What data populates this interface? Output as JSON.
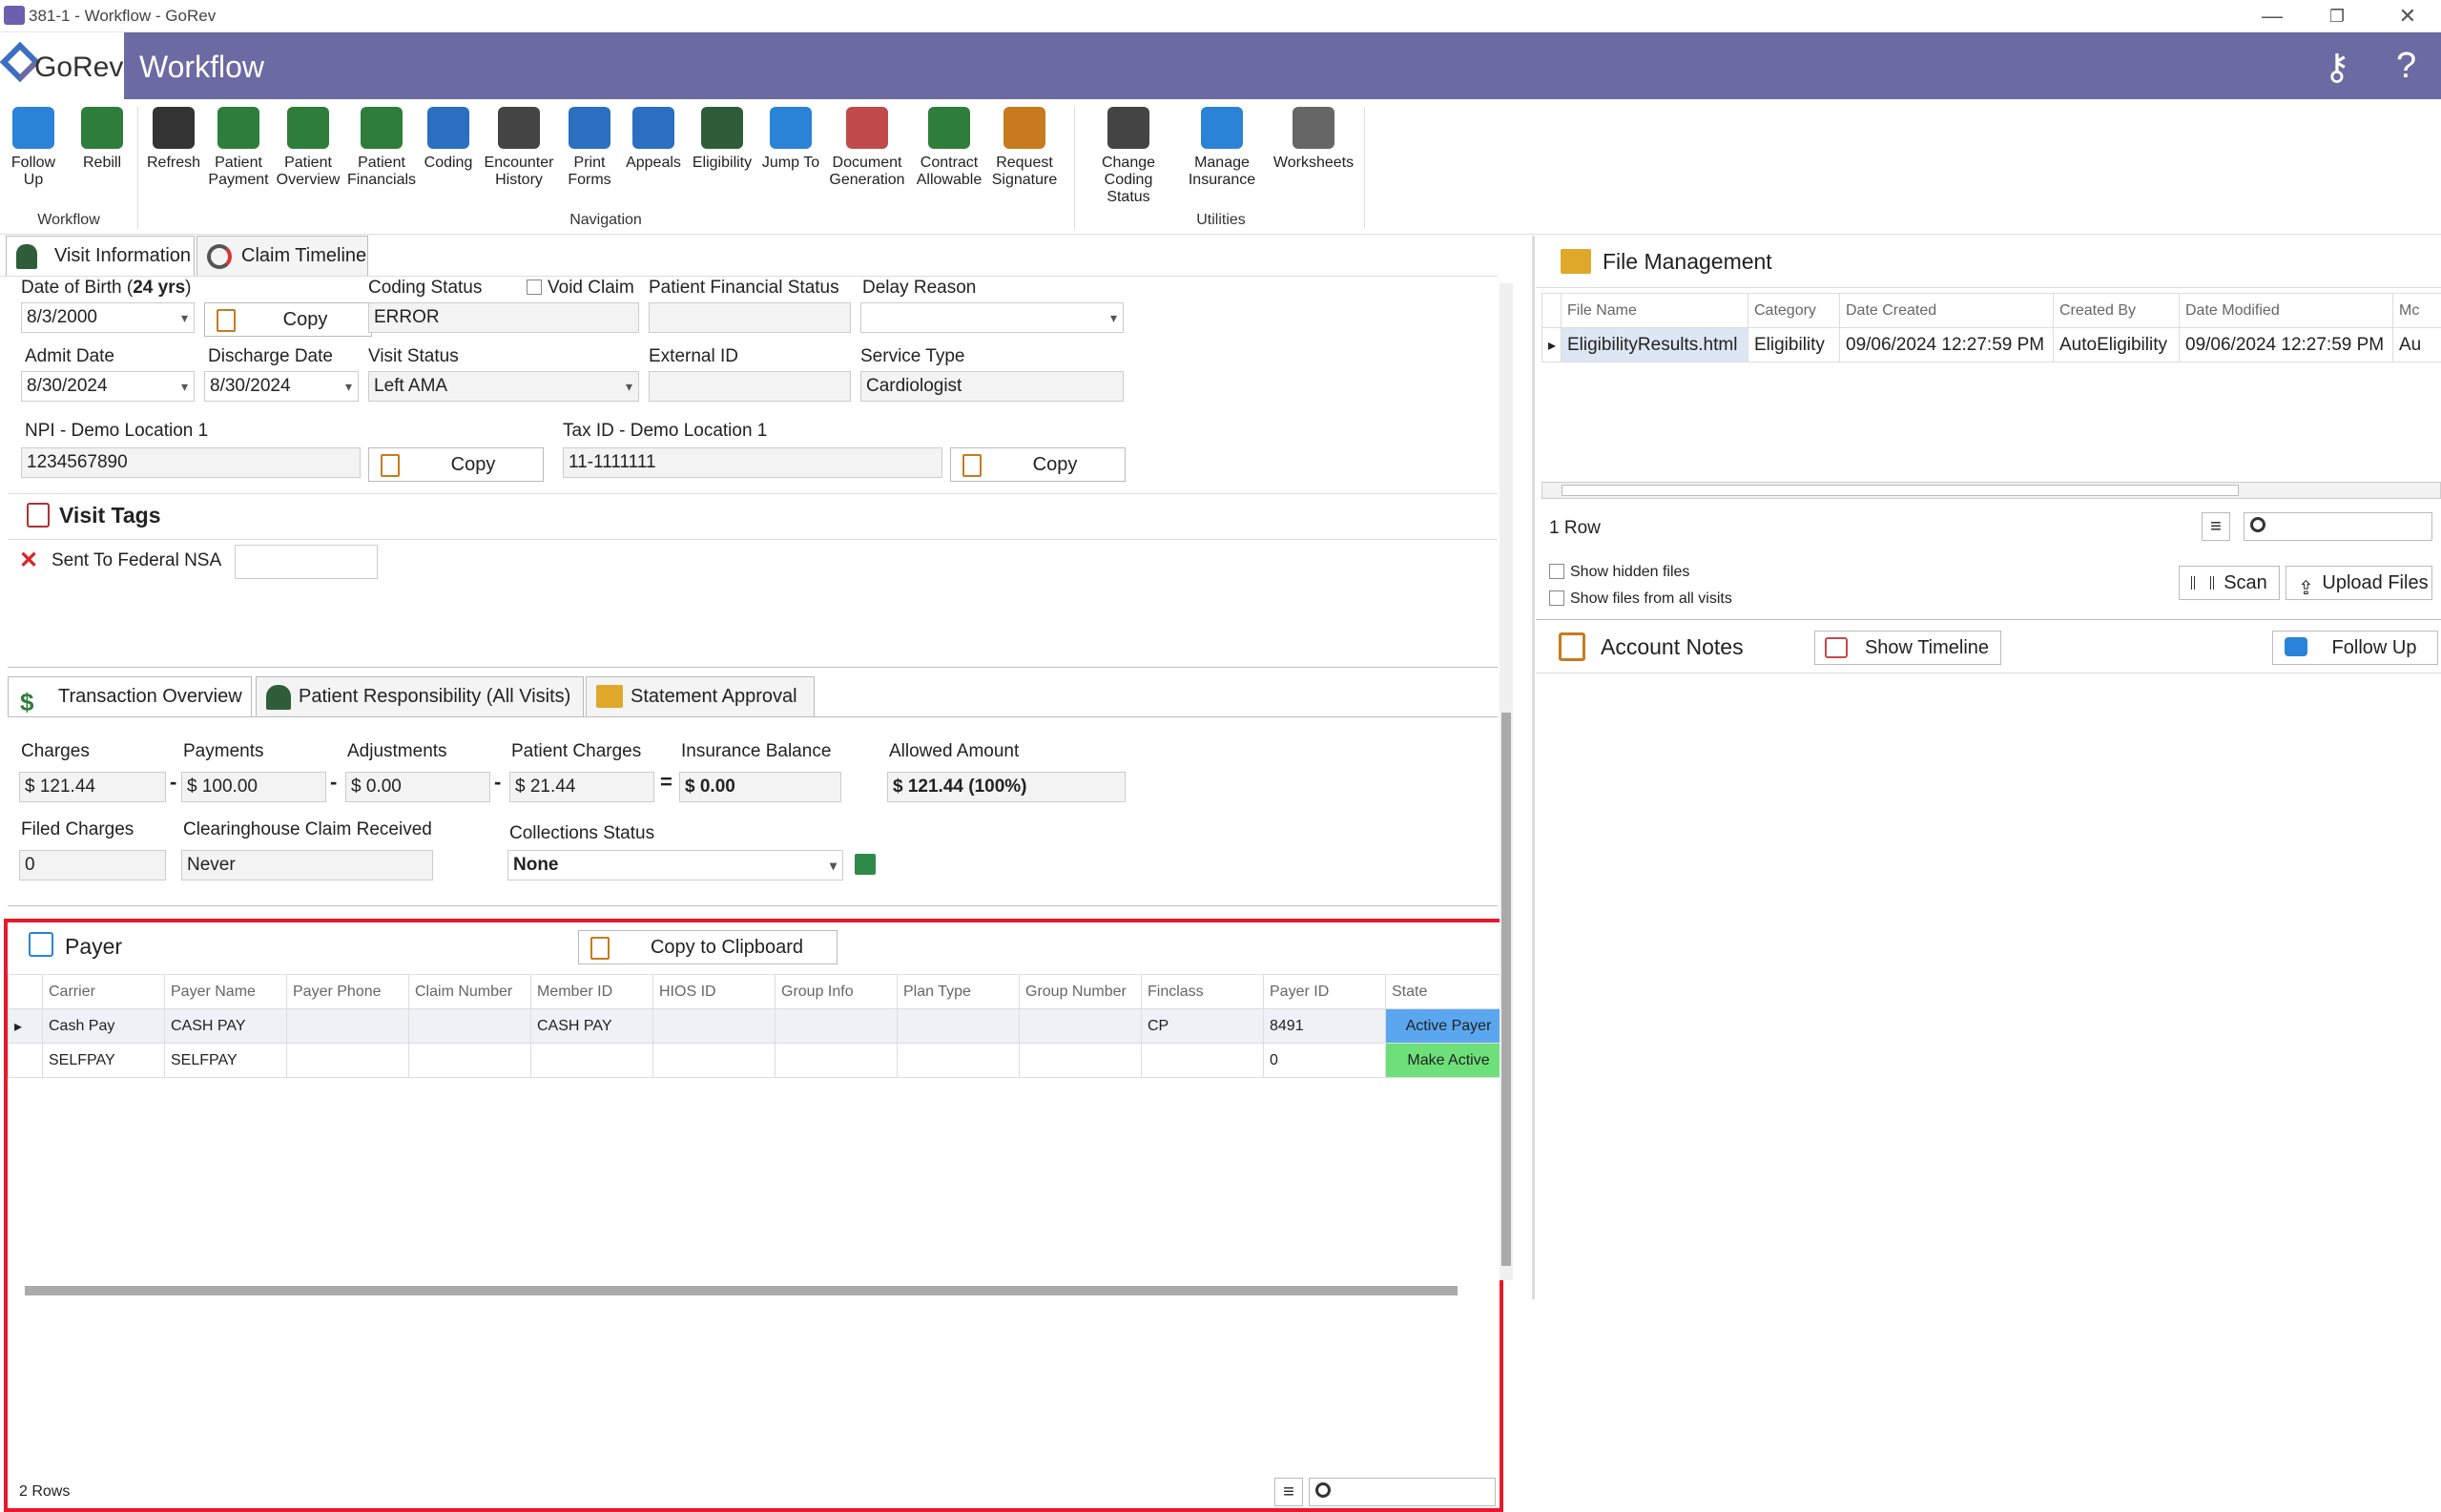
{
  "window": {
    "title": "381-1 - Workflow - GoRev",
    "min": "—",
    "max": "❐",
    "close": "✕"
  },
  "header": {
    "logo": "GoRev",
    "title": "Workflow",
    "help": "?",
    "keys_icon": "keys-icon"
  },
  "ribbon": {
    "workflow": [
      {
        "label": "Follow\nUp",
        "color": "#2a83d6"
      },
      {
        "label": "Rebill",
        "color": "#2f7d3a"
      }
    ],
    "navigation": [
      {
        "label": "Refresh",
        "color": "#333"
      },
      {
        "label": "Patient\nPayment",
        "color": "#2f7d3a"
      },
      {
        "label": "Patient\nOverview",
        "color": "#2f7d3a"
      },
      {
        "label": "Patient\nFinancials",
        "color": "#2f7d3a"
      },
      {
        "label": "Coding",
        "color": "#2a6fc2"
      },
      {
        "label": "Encounter\nHistory",
        "color": "#444"
      },
      {
        "label": "Print\nForms",
        "color": "#2a6fc2"
      },
      {
        "label": "Appeals",
        "color": "#2a6fc2"
      },
      {
        "label": "Eligibility",
        "color": "#2f5d3a"
      },
      {
        "label": "Jump To",
        "color": "#2a83d6"
      },
      {
        "label": "Document\nGeneration",
        "color": "#c04a4a"
      },
      {
        "label": "Contract\nAllowable",
        "color": "#2f7d3a"
      },
      {
        "label": "Request\nSignature",
        "color": "#c87a1f"
      }
    ],
    "utilities": [
      {
        "label": "Change Coding\nStatus",
        "color": "#444"
      },
      {
        "label": "Manage\nInsurance",
        "color": "#2a83d6"
      },
      {
        "label": "Worksheets",
        "color": "#666"
      }
    ],
    "groups": {
      "workflow": "Workflow",
      "navigation": "Navigation",
      "utilities": "Utilities"
    }
  },
  "tabs": {
    "visit_info": "Visit Information",
    "claim_timeline": "Claim Timeline"
  },
  "visit": {
    "dob_label": "Date of Birth (",
    "dob_age": "24 yrs",
    "dob_close": ")",
    "dob": "8/3/2000",
    "copy": "Copy",
    "coding_status_label": "Coding Status",
    "coding_status": "ERROR",
    "void_claim": "Void Claim",
    "pfs_label": "Patient Financial Status",
    "pfs": "",
    "delay_label": "Delay Reason",
    "delay": "",
    "admit_label": "Admit Date",
    "admit": "8/30/2024",
    "discharge_label": "Discharge Date",
    "discharge": "8/30/2024",
    "visit_status_label": "Visit Status",
    "visit_status": "Left AMA",
    "external_label": "External ID",
    "external": "",
    "service_label": "Service Type",
    "service": "Cardiologist",
    "npi_label": "NPI - Demo Location 1",
    "npi": "1234567890",
    "tax_label": "Tax ID - Demo Location 1",
    "tax": "11-1111111"
  },
  "visit_tags": {
    "title": "Visit Tags",
    "tag": "Sent To Federal NSA",
    "tag_value": ""
  },
  "trans_tabs": {
    "overview": "Transaction Overview",
    "responsibility": "Patient Responsibility (All Visits)",
    "statement": "Statement Approval"
  },
  "trans": {
    "charges_label": "Charges",
    "charges": "$ 121.44",
    "payments_label": "Payments",
    "payments": "$ 100.00",
    "adjust_label": "Adjustments",
    "adjust": "$ 0.00",
    "pcharges_label": "Patient Charges",
    "pcharges": "$ 21.44",
    "ins_label": "Insurance Balance",
    "ins": "$ 0.00",
    "allowed_label": "Allowed Amount",
    "allowed": "$ 121.44 (100%)",
    "filed_label": "Filed Charges",
    "filed": "0",
    "clearing_label": "Clearinghouse Claim Received",
    "clearing": "Never",
    "collections_label": "Collections Status",
    "collections": "None",
    "minus": "-",
    "equals": "="
  },
  "payer": {
    "title": "Payer",
    "copy_btn": "Copy to Clipboard",
    "rows_count": "2 Rows",
    "columns": [
      "Carrier",
      "Payer Name",
      "Payer Phone",
      "Claim Number",
      "Member ID",
      "HIOS ID",
      "Group Info",
      "Plan Type",
      "Group Number",
      "Finclass",
      "Payer ID",
      "State"
    ],
    "rows": [
      {
        "carrier": "Cash Pay",
        "name": "CASH PAY",
        "phone": "",
        "claim": "",
        "member": "CASH PAY",
        "hios": "",
        "ginfo": "",
        "plan": "",
        "gnum": "",
        "finclass": "CP",
        "payerid": "8491",
        "state": "Active Payer"
      },
      {
        "carrier": "SELFPAY",
        "name": "SELFPAY",
        "phone": "",
        "claim": "",
        "member": "",
        "hios": "",
        "ginfo": "",
        "plan": "",
        "gnum": "",
        "finclass": "",
        "payerid": "0",
        "state": "Make Active"
      }
    ],
    "colors": {
      "active": "#5aa7f0",
      "make_active": "#6de07a",
      "highlight": "#e8192c"
    }
  },
  "files": {
    "title": "File Management",
    "columns": [
      "File Name",
      "Category",
      "Date Created",
      "Created By",
      "Date Modified",
      "Mc"
    ],
    "rows": [
      {
        "name": "EligibilityResults.html",
        "category": "Eligibility",
        "created": "09/06/2024 12:27:59 PM",
        "by": "AutoEligibility",
        "modified": "09/06/2024 12:27:59 PM",
        "mc": "Au"
      }
    ],
    "rows_count": "1 Row",
    "show_hidden": "Show hidden files",
    "show_all": "Show files from all visits",
    "scan": "Scan",
    "upload": "Upload Files"
  },
  "notes": {
    "title": "Account Notes",
    "timeline": "Show Timeline",
    "follow": "Follow Up"
  }
}
